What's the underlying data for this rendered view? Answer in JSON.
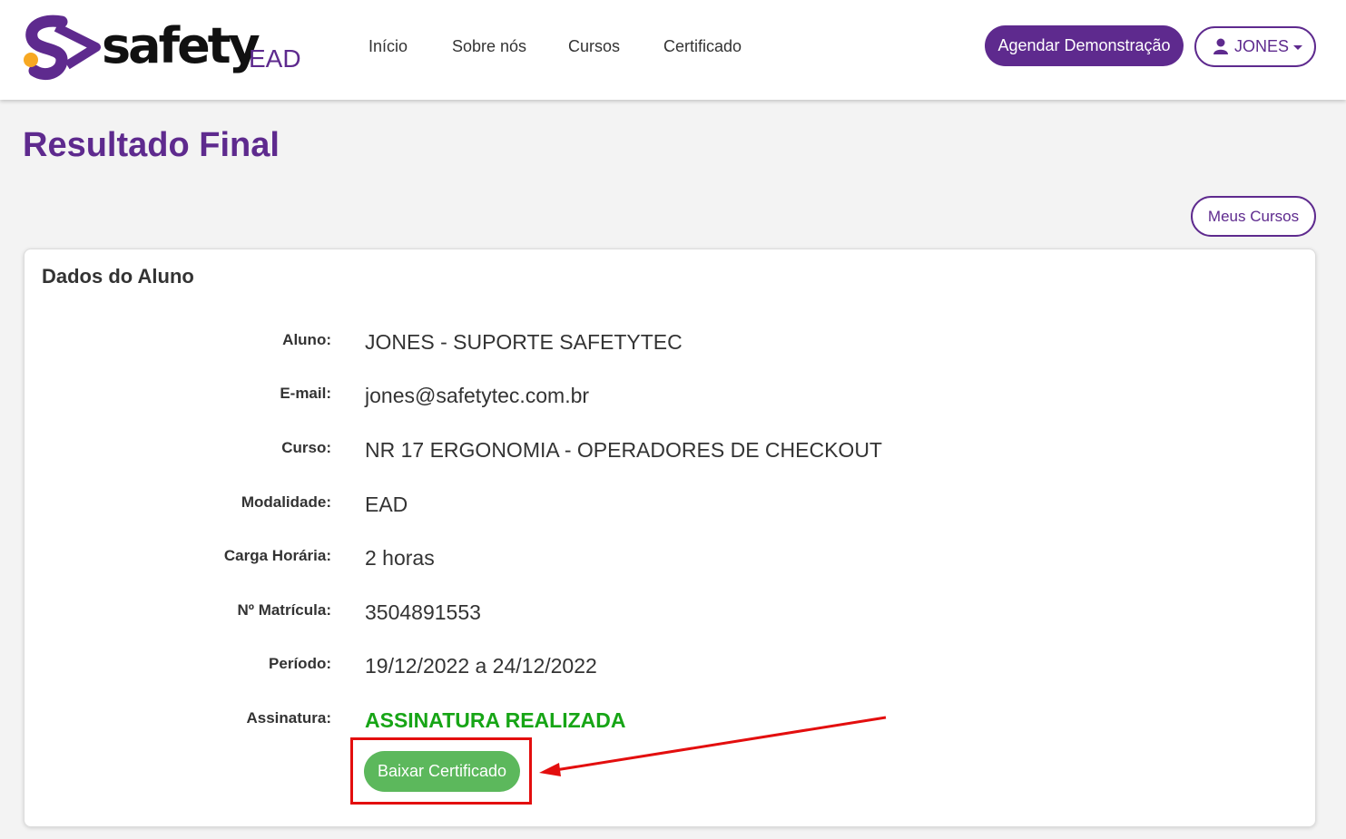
{
  "header": {
    "logo_word": "safety",
    "logo_suffix": "EAD",
    "nav": [
      {
        "label": "Início"
      },
      {
        "label": "Sobre nós"
      },
      {
        "label": "Cursos"
      },
      {
        "label": "Certificado"
      }
    ],
    "demo_button": "Agendar Demonstração",
    "user_button": "JONES"
  },
  "page": {
    "title": "Resultado Final",
    "my_courses_button": "Meus Cursos"
  },
  "card": {
    "title": "Dados do Aluno",
    "rows": [
      {
        "label": "Aluno:",
        "value": "JONES - SUPORTE SAFETYTEC"
      },
      {
        "label": "E-mail:",
        "value": "jones@safetytec.com.br"
      },
      {
        "label": "Curso:",
        "value": "NR 17 ERGONOMIA - OPERADORES DE CHECKOUT"
      },
      {
        "label": "Modalidade:",
        "value": "EAD"
      },
      {
        "label": "Carga Horária:",
        "value": "2 horas"
      },
      {
        "label": "Nº Matrícula:",
        "value": "3504891553"
      },
      {
        "label": "Período:",
        "value": "19/12/2022 a 24/12/2022"
      },
      {
        "label": "Assinatura:",
        "value": "ASSINATURA REALIZADA"
      }
    ],
    "download_button": "Baixar Certificado"
  },
  "colors": {
    "brand_purple": "#5e2a8e",
    "logo_orange": "#f7a823",
    "success_green": "#17a516",
    "button_green": "#5cb85c",
    "annotation_red": "#e30e0e"
  },
  "icons": [
    "user-icon",
    "chevron-down-icon",
    "logo-s-icon",
    "arrow-annotation"
  ]
}
